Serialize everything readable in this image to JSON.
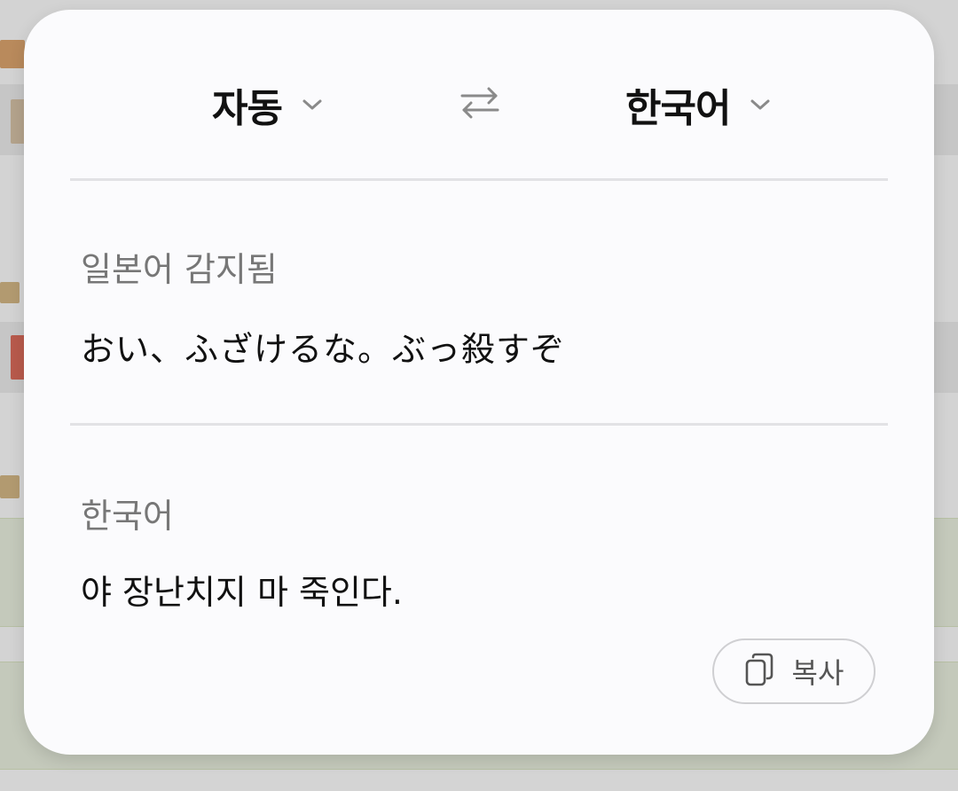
{
  "source_language": {
    "label": "자동",
    "dropdown_icon": "chevron-down-icon"
  },
  "swap_icon": "swap-arrows-icon",
  "target_language": {
    "label": "한국어",
    "dropdown_icon": "chevron-down-icon"
  },
  "source_section": {
    "detected_label": "일본어 감지됨",
    "text": "おい、ふざけるな。ぶっ殺すぞ"
  },
  "target_section": {
    "label": "한국어",
    "text": "야 장난치지 마 죽인다."
  },
  "copy_button": {
    "icon": "copy-icon",
    "label": "복사"
  },
  "colors": {
    "popup_bg": "#fbfbfd",
    "primary_text": "#111111",
    "secondary_text": "#777777",
    "icon_gray": "#8a8a8a",
    "divider": "#e2e2e5"
  }
}
